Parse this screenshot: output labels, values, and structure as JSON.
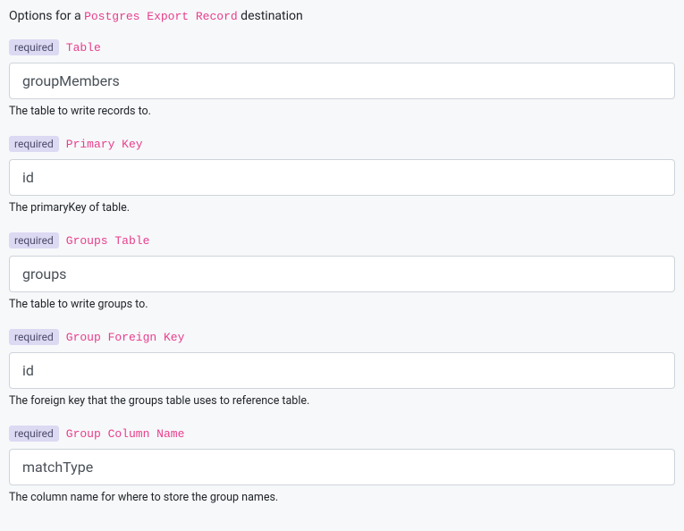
{
  "header": {
    "prefix": "Options for a ",
    "code": "Postgres Export Record",
    "suffix": " destination"
  },
  "required_label": "required",
  "fields": {
    "table": {
      "label": "Table",
      "value": "groupMembers",
      "help": "The table to write records to."
    },
    "primaryKey": {
      "label": "Primary Key",
      "value": "id",
      "help": "The primaryKey of table."
    },
    "groupsTable": {
      "label": "Groups Table",
      "value": "groups",
      "help": "The table to write groups to."
    },
    "groupForeignKey": {
      "label": "Group Foreign Key",
      "value": "id",
      "help": "The foreign key that the groups table uses to reference table."
    },
    "groupColumnName": {
      "label": "Group Column Name",
      "value": "matchType",
      "help": "The column name for where to store the group names."
    }
  }
}
